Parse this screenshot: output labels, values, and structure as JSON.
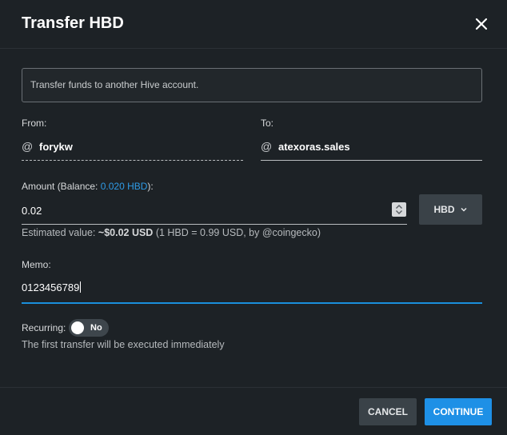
{
  "dialog": {
    "title": "Transfer HBD",
    "close_icon": "close-icon"
  },
  "info": {
    "text": "Transfer funds to another Hive account."
  },
  "from": {
    "label": "From:",
    "at_symbol": "@",
    "value": "forykw"
  },
  "to": {
    "label": "To:",
    "at_symbol": "@",
    "value": "atexoras.sales"
  },
  "amount": {
    "label_prefix": "Amount (Balance: ",
    "balance": "0.020 HBD",
    "label_suffix": "):",
    "value": "0.02",
    "currency": "HBD",
    "estimated_prefix": "Estimated value: ",
    "estimated_value": "~$0.02 USD",
    "estimated_suffix": " (1 HBD = 0.99 USD, by @coingecko)"
  },
  "memo": {
    "label": "Memo:",
    "value": "0123456789"
  },
  "recurring": {
    "label": "Recurring:",
    "state": "No",
    "hint": "The first transfer will be executed immediately"
  },
  "footer": {
    "cancel_label": "CANCEL",
    "continue_label": "CONTINUE"
  },
  "colors": {
    "background": "#1d2226",
    "accent": "#1e90e6",
    "link": "#2f9be6",
    "button_secondary": "#3a4248"
  }
}
